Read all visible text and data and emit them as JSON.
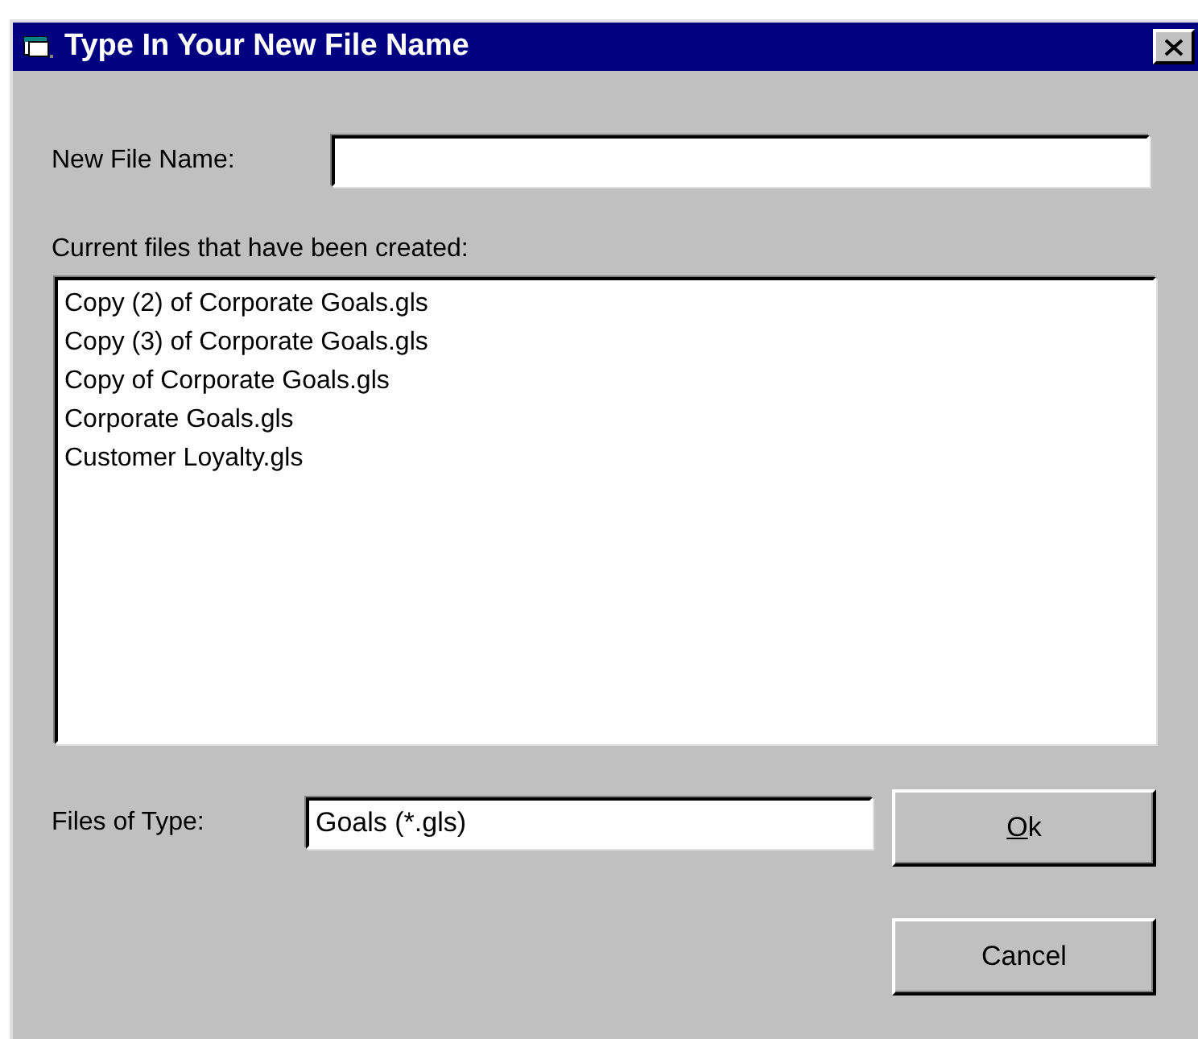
{
  "window": {
    "title": "Type In Your New File Name"
  },
  "new_file_name": {
    "label": "New File Name:"
  },
  "files_list": {
    "label": "Current files that have been created:",
    "items": [
      {
        "name": "Copy (2) of Corporate Goals.gls"
      },
      {
        "name": "Copy (3) of Corporate Goals.gls"
      },
      {
        "name": "Copy of Corporate Goals.gls"
      },
      {
        "name": "Corporate Goals.gls"
      },
      {
        "name": "Customer Loyalty.gls"
      }
    ]
  },
  "files_of_type": {
    "label": "Files of Type:",
    "value": "Goals (*.gls)"
  },
  "buttons": [
    {
      "label": "Ok",
      "first_letter_underlined": true
    },
    {
      "label": "Cancel",
      "first_letter_underlined": false
    }
  ]
}
